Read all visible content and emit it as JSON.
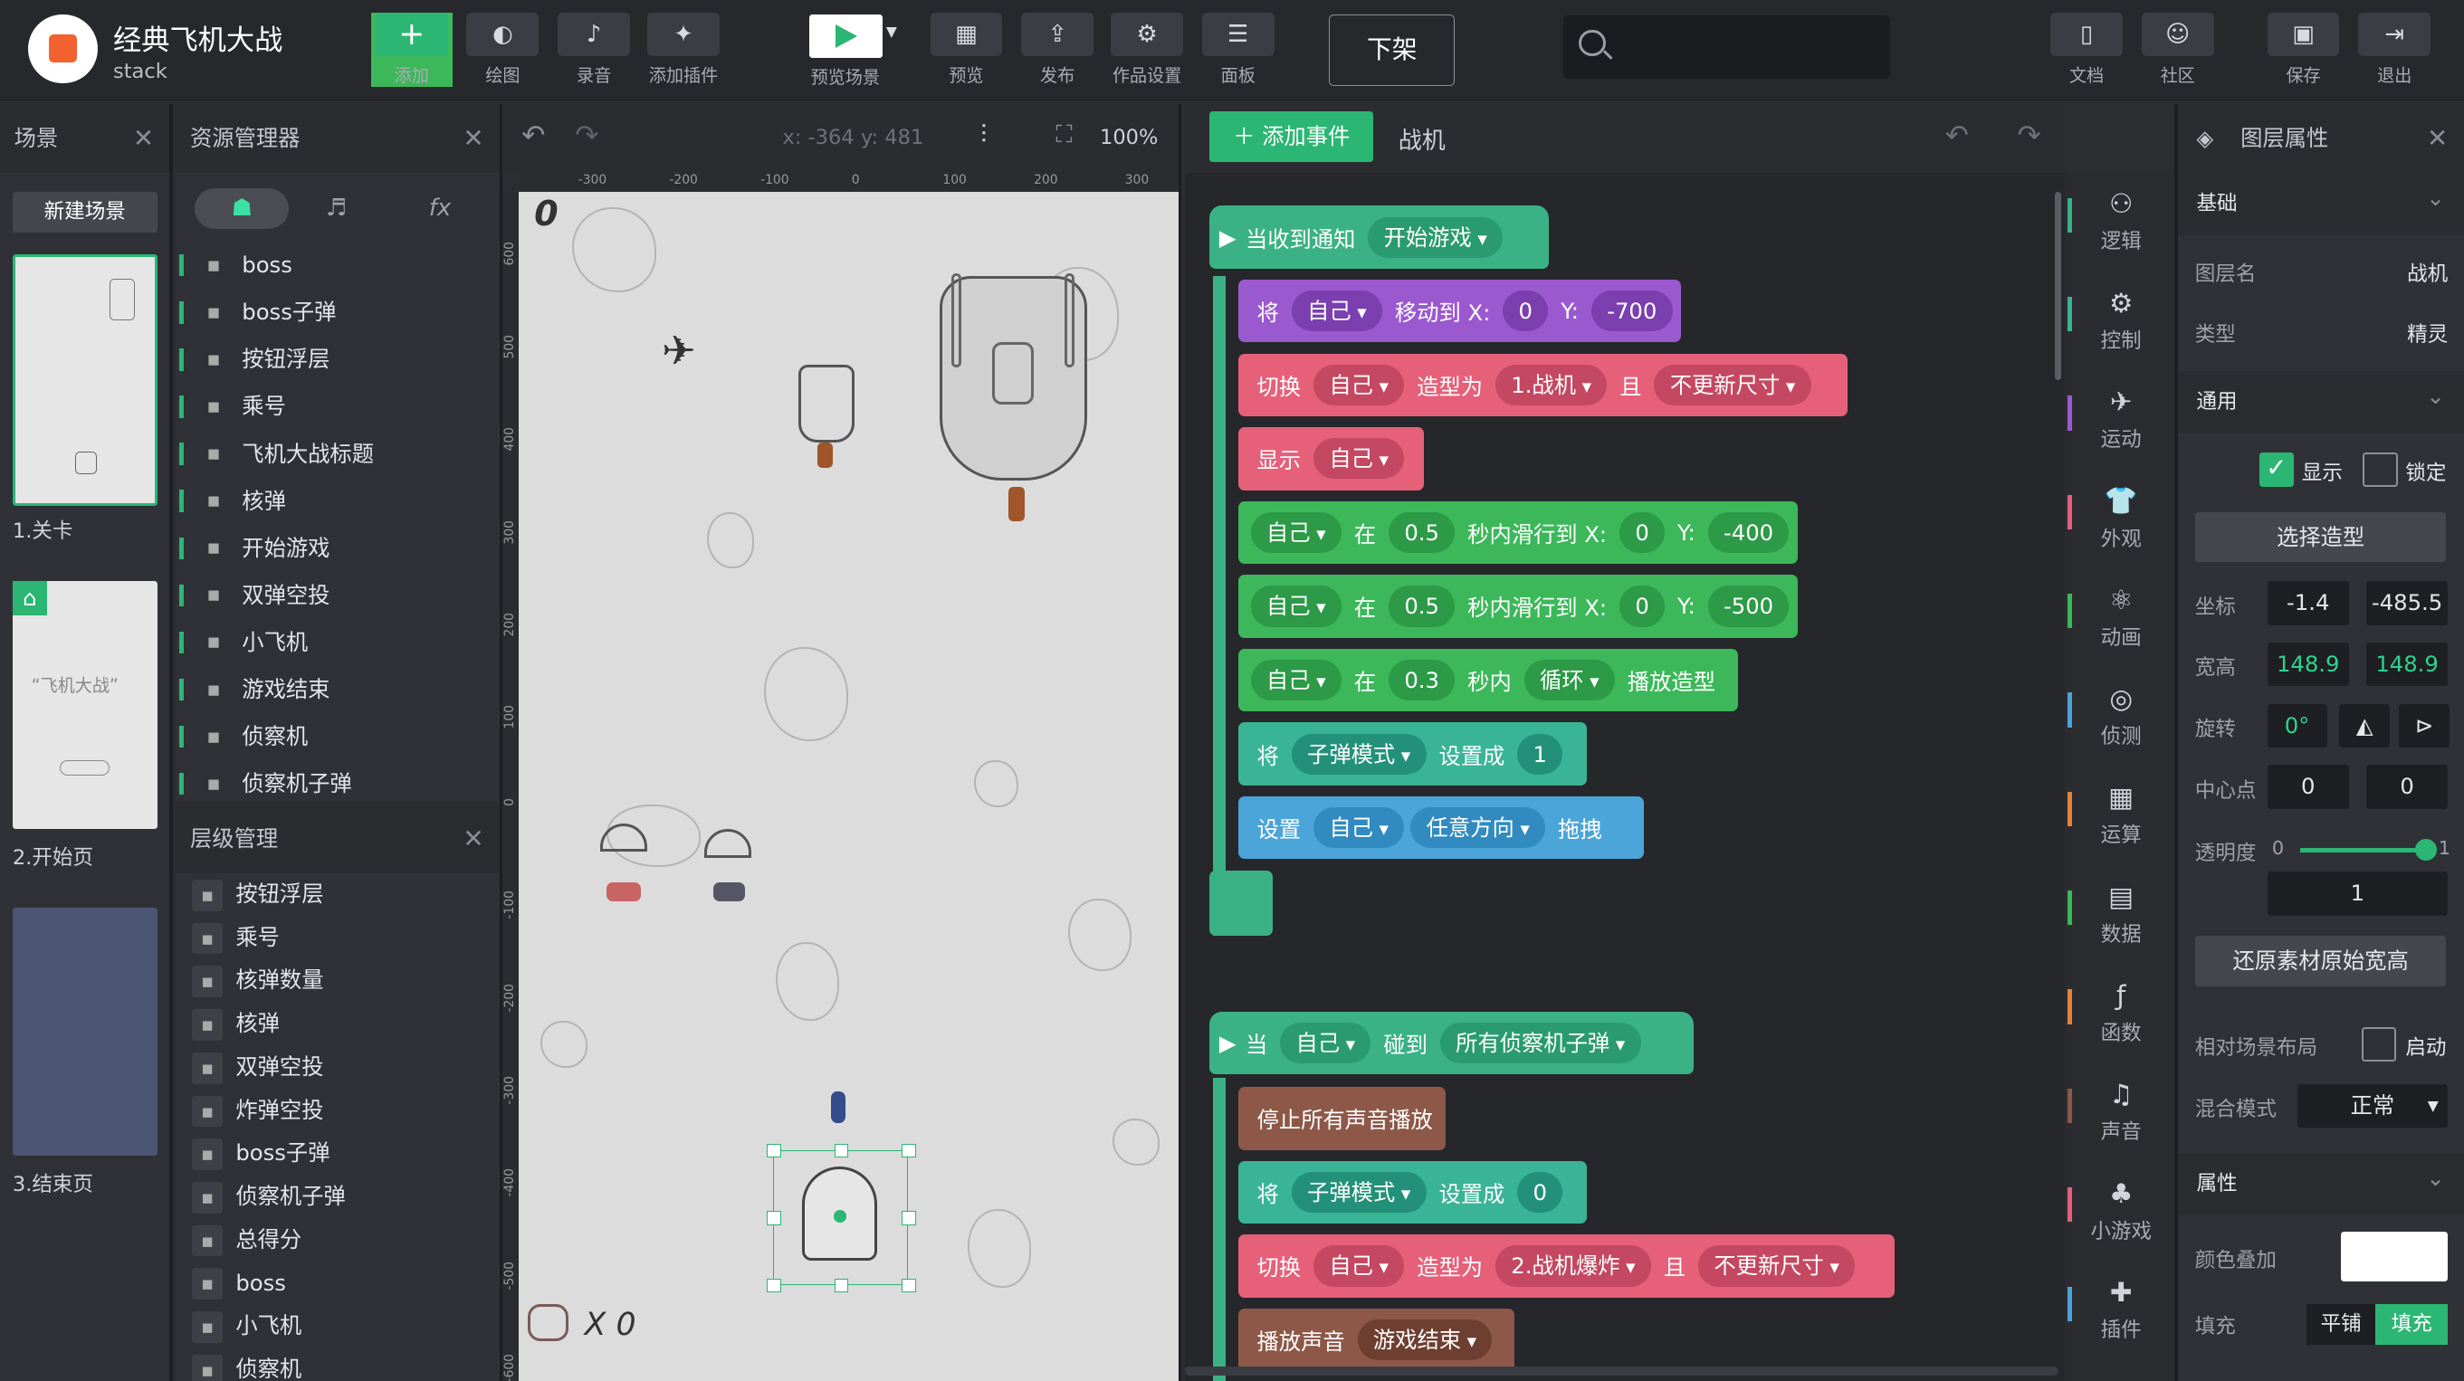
{
  "project": {
    "title": "经典飞机大战",
    "user": "stack"
  },
  "toolbar": {
    "add": "添加",
    "draw": "绘图",
    "record": "录音",
    "plugin": "添加插件",
    "preview_scene": "预览场景",
    "preview": "预览",
    "publish": "发布",
    "work_settings": "作品设置",
    "panel": "面板",
    "off_shelf": "下架",
    "docs": "文档",
    "community": "社区",
    "save": "保存",
    "exit": "退出"
  },
  "scenes": {
    "title": "场景",
    "new_label": "新建场景",
    "items": [
      {
        "label": "1.关卡"
      },
      {
        "label": "2.开始页"
      },
      {
        "label": "3.结束页"
      }
    ]
  },
  "resources": {
    "title": "资源管理器",
    "tab_fx": "fx",
    "items": [
      {
        "label": "boss"
      },
      {
        "label": "boss子弹"
      },
      {
        "label": "按钮浮层"
      },
      {
        "label": "乘号"
      },
      {
        "label": "飞机大战标题"
      },
      {
        "label": "核弹"
      },
      {
        "label": "开始游戏"
      },
      {
        "label": "双弹空投"
      },
      {
        "label": "小飞机"
      },
      {
        "label": "游戏结束"
      },
      {
        "label": "侦察机"
      },
      {
        "label": "侦察机子弹"
      }
    ]
  },
  "layers": {
    "title": "层级管理",
    "items": [
      {
        "label": "按钮浮层"
      },
      {
        "label": "乘号"
      },
      {
        "label": "核弹数量"
      },
      {
        "label": "核弹"
      },
      {
        "label": "双弹空投"
      },
      {
        "label": "炸弹空投"
      },
      {
        "label": "boss子弹"
      },
      {
        "label": "侦察机子弹"
      },
      {
        "label": "总得分"
      },
      {
        "label": "boss"
      },
      {
        "label": "小飞机"
      },
      {
        "label": "侦察机"
      }
    ]
  },
  "stage": {
    "coord": "x: -364   y: 481",
    "zoom": "100%",
    "score": "0",
    "bomb_count": "X 0",
    "ruler_x": [
      "-300",
      "-200",
      "-100",
      "0",
      "100",
      "200",
      "300"
    ],
    "ruler_y": [
      "600",
      "500",
      "400",
      "300",
      "200",
      "100",
      "0",
      "-100",
      "-200",
      "-300",
      "-400",
      "-500",
      "-600"
    ]
  },
  "editor": {
    "add_event": "添加事件",
    "sprite": "战机",
    "event1": {
      "hat": "当收到通知",
      "msg": "开始游戏",
      "b1": {
        "a": "将",
        "who": "自己",
        "b": "移动到 X:",
        "x": "0",
        "c": "Y:",
        "y": "-700"
      },
      "b2": {
        "a": "切换",
        "who": "自己",
        "b": "造型为",
        "look": "1.战机",
        "c": "且",
        "size": "不更新尺寸"
      },
      "b3": {
        "a": "显示",
        "who": "自己"
      },
      "b4": {
        "who": "自己",
        "a": "在",
        "t": "0.5",
        "b": "秒内滑行到 X:",
        "x": "0",
        "c": "Y:",
        "y": "-400"
      },
      "b5": {
        "who": "自己",
        "a": "在",
        "t": "0.5",
        "b": "秒内滑行到 X:",
        "x": "0",
        "c": "Y:",
        "y": "-500"
      },
      "b6": {
        "who": "自己",
        "a": "在",
        "t": "0.3",
        "b": "秒内",
        "mode": "循环",
        "c": "播放造型"
      },
      "b7": {
        "a": "将",
        "var": "子弹模式",
        "b": "设置成",
        "val": "1"
      },
      "b8": {
        "a": "设置",
        "who": "自己",
        "dir": "任意方向",
        "b": "拖拽"
      }
    },
    "event2": {
      "hat": "当",
      "who": "自己",
      "touch": "碰到",
      "target": "所有侦察机子弹",
      "b1": {
        "a": "停止所有声音播放"
      },
      "b2": {
        "a": "将",
        "var": "子弹模式",
        "b": "设置成",
        "val": "0"
      },
      "b3": {
        "a": "切换",
        "who": "自己",
        "b": "造型为",
        "look": "2.战机爆炸",
        "c": "且",
        "size": "不更新尺寸"
      },
      "b4": {
        "a": "播放声音",
        "sound": "游戏结束"
      }
    }
  },
  "categories": [
    {
      "label": "逻辑",
      "color": "#3ab286"
    },
    {
      "label": "控制",
      "color": "#39b497"
    },
    {
      "label": "运动",
      "color": "#9b59d0"
    },
    {
      "label": "外观",
      "color": "#e6607a"
    },
    {
      "label": "动画",
      "color": "#3cb85a"
    },
    {
      "label": "侦测",
      "color": "#4ba5d8"
    },
    {
      "label": "运算",
      "color": "#e2833a"
    },
    {
      "label": "数据",
      "color": "#3cb85a"
    },
    {
      "label": "函数",
      "color": "#e2833a"
    },
    {
      "label": "声音",
      "color": "#8d5848"
    },
    {
      "label": "小游戏",
      "color": "#e6607a"
    },
    {
      "label": "插件",
      "color": "#4ba5d8"
    }
  ],
  "props": {
    "title": "图层属性",
    "basic": {
      "title": "基础",
      "name_label": "图层名",
      "name": "战机",
      "type_label": "类型",
      "type": "精灵"
    },
    "common": {
      "title": "通用",
      "show": "显示",
      "lock": "锁定",
      "choose_look": "选择造型",
      "pos_label": "坐标",
      "x": "-1.4",
      "y": "-485.5",
      "size_label": "宽高",
      "w": "148.9",
      "h": "148.9",
      "rot_label": "旋转",
      "rot": "0°",
      "center_label": "中心点",
      "cx": "0",
      "cy": "0",
      "alpha_label": "透明度",
      "alpha_min": "0",
      "alpha_max": "1",
      "alpha": "1",
      "alpha_level": 1,
      "restore": "还原素材原始宽高",
      "rel_label": "相对场景布局",
      "rel": "启动",
      "blend_label": "混合模式",
      "blend": "正常"
    },
    "attrs": {
      "title": "属性",
      "tint_label": "颜色叠加",
      "fill_label": "填充",
      "tile": "平铺",
      "fill": "填充"
    }
  }
}
